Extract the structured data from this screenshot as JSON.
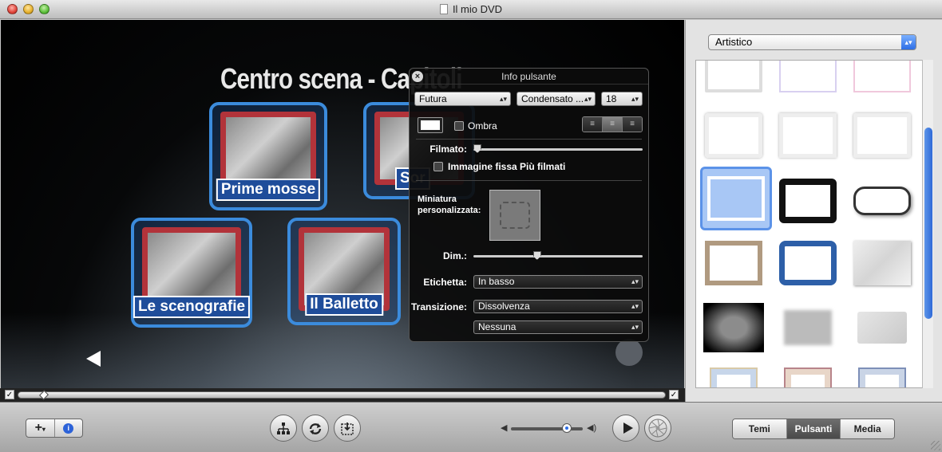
{
  "window": {
    "title": "Il mio DVD"
  },
  "stage": {
    "title": "Centro scena - Capitoli",
    "buttons": [
      {
        "label": "Prime mosse"
      },
      {
        "label": "Sor"
      },
      {
        "label": "Le scenografie"
      },
      {
        "label": "Il Balletto"
      }
    ]
  },
  "panel": {
    "title": "Info pulsante",
    "font": "Futura",
    "style": "Condensato ...",
    "size": "18",
    "shadow_label": "Ombra",
    "movie_label": "Filmato:",
    "still_label": "Immagine fissa",
    "more_movies": "Più filmati",
    "custom_thumb_label": "Miniatura personalizzata:",
    "size_label": "Dim.:",
    "label_label": "Etichetta:",
    "label_value": "In basso",
    "transition_label": "Transizione:",
    "transition_value": "Dissolvenza",
    "direction_value": "Nessuna",
    "movie_slider": 0,
    "size_slider": 0.37
  },
  "sidebar": {
    "category": "Artistico"
  },
  "toolbar": {
    "tabs": [
      "Temi",
      "Pulsanti",
      "Media"
    ],
    "active_tab": "Pulsanti",
    "volume": 0.78
  },
  "icons": {
    "add": "plus-icon",
    "info": "info-icon",
    "map": "map-icon",
    "loop": "loop-icon",
    "burn": "burn-icon",
    "play": "play-icon",
    "disc": "disc-icon"
  },
  "colors": {
    "button_frame": "#3b8bdc",
    "frame_red": "#b2333a",
    "accent_blue": "#2d6ee6"
  }
}
